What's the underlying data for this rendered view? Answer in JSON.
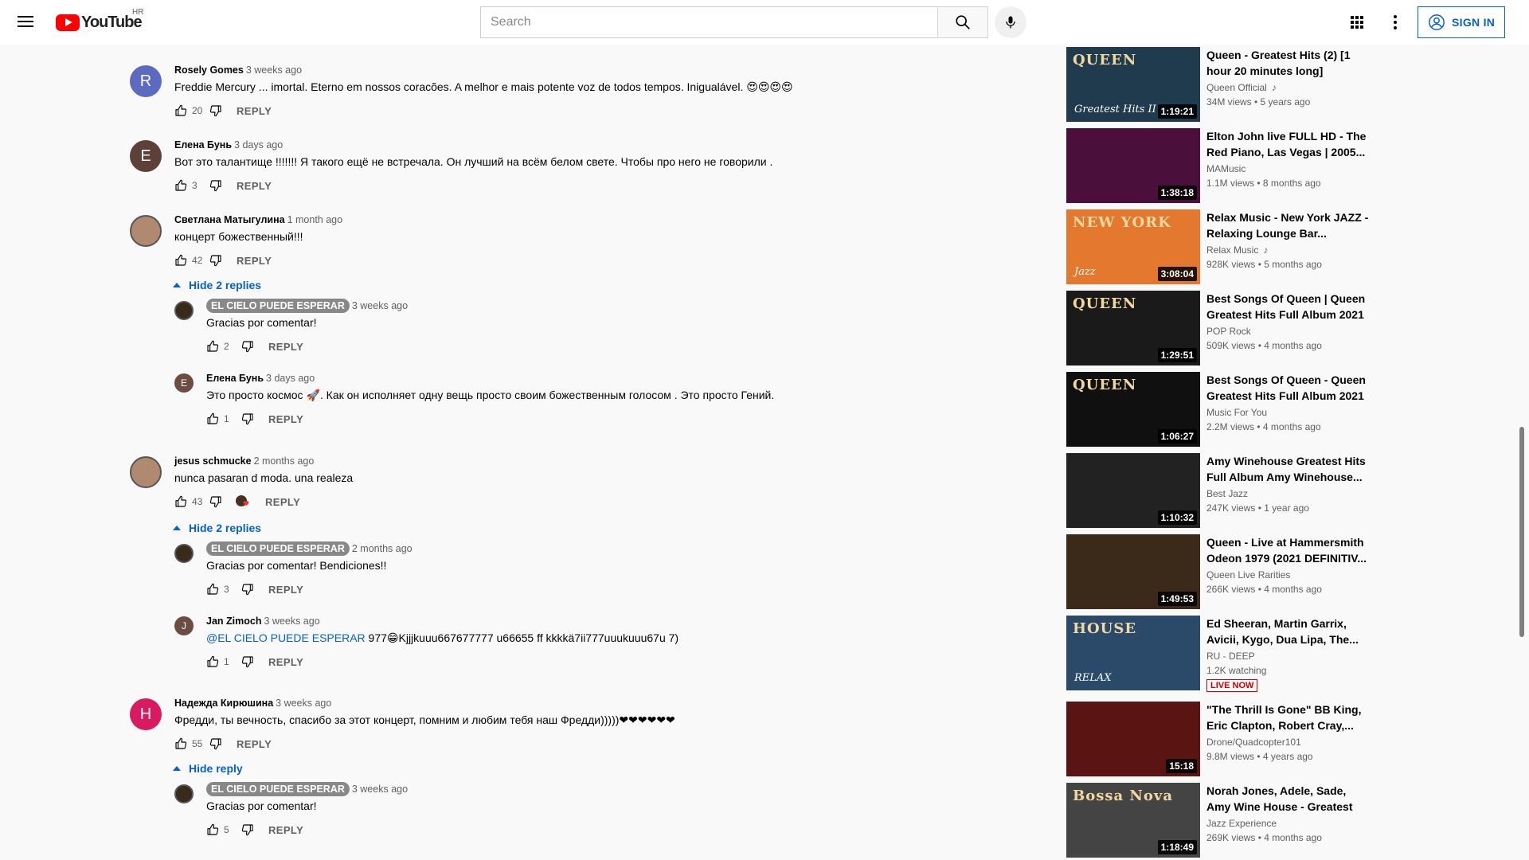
{
  "header": {
    "logo_text": "YouTube",
    "country": "HR",
    "search_placeholder": "Search",
    "signin_label": "SIGN IN"
  },
  "comments": [
    {
      "author": "Rosely Gomes",
      "time": "3 weeks ago",
      "text": "Freddie Mercury ... imortal. Eterno em nossos coracões. A melhor e mais potente voz de todos tempos. Inigualável. 😍😍😍😍",
      "likes": "20",
      "avatar_letter": "R",
      "avatar_color": "#5c6bc0"
    },
    {
      "author": "Елена Бунь",
      "time": "3 days ago",
      "text": "Вот это талантище !!!!!!! Я такого ещё не встречала. Он лучший на всём белом свете. Чтобы про него не говорили .",
      "likes": "3",
      "avatar_letter": "E",
      "avatar_color": "#5d4037"
    },
    {
      "author": "Светлана Матыгулина",
      "time": "1 month ago",
      "text": "концерт божественный!!!",
      "likes": "42",
      "hide_label": "Hide 2 replies",
      "replies": [
        {
          "author": "EL CIELO PUEDE ESPERAR",
          "time": "3 weeks ago",
          "text": "Gracias por comentar!",
          "likes": "2"
        },
        {
          "author": "Елена Бунь",
          "time": "3 days ago",
          "text": "Это просто космос 🚀. Как он исполняет одну вещь просто своим божественным голосом . Это просто Гений.",
          "likes": "1",
          "avatar_letter": "E"
        }
      ]
    },
    {
      "author": "jesus schmucke",
      "time": "2 months ago",
      "text": "nunca pasaran d moda. una realeza",
      "likes": "43",
      "hide_label": "Hide 2 replies",
      "replies": [
        {
          "author": "EL CIELO PUEDE ESPERAR",
          "time": "2 months ago",
          "text": "Gracias por comentar! Bendiciones!!",
          "likes": "3"
        },
        {
          "author": "Jan Zimoch",
          "time": "3 weeks ago",
          "mention": "@EL CIELO PUEDE ESPERAR",
          "text": " 977😁Kjjjkuuu667677777 u66655 ff kkkkä7ii777uuukuuu67u 7)",
          "likes": "1",
          "avatar_letter": "J"
        }
      ]
    },
    {
      "author": "Надежда Кирюшина",
      "time": "3 weeks ago",
      "text": "Фредди, ты вечность, спасибо за этот концерт, помним и любим тебя наш Фредди)))))❤❤❤❤❤❤",
      "likes": "55",
      "avatar_letter": "H",
      "avatar_color": "#d81b60",
      "hide_label": "Hide reply",
      "replies": [
        {
          "author": "EL CIELO PUEDE ESPERAR",
          "time": "3 weeks ago",
          "text": "Gracias por comentar!",
          "likes": "5"
        }
      ]
    }
  ],
  "reply_label": "REPLY",
  "recommendations": [
    {
      "title": "Queen - Greatest Hits (2) [1 hour 20 minutes long]",
      "channel": "Queen Official",
      "meta": "34M views • 5 years ago",
      "duration": "1:19:21",
      "thumb_color": "#1f3b4d",
      "thumb_text": "QUEEN",
      "thumb_subtext": "Greatest Hits II",
      "music_note": "♪"
    },
    {
      "title": "Elton John live FULL HD - The Red Piano, Las Vegas | 2005...",
      "channel": "MAMusic",
      "meta": "1.1M views • 8 months ago",
      "duration": "1:38:18",
      "thumb_color": "#4a0f3a"
    },
    {
      "title": "Relax Music - New York JAZZ - Relaxing Lounge Bar...",
      "channel": "Relax Music",
      "meta": "928K views • 5 months ago",
      "duration": "3:08:04",
      "thumb_color": "#e3782e",
      "thumb_text": "NEW YORK",
      "thumb_subtext": "Jazz",
      "music_note": "♪"
    },
    {
      "title": "Best Songs Of Queen | Queen Greatest Hits Full Album 2021",
      "channel": "POP Rock",
      "meta": "509K views • 4 months ago",
      "duration": "1:29:51",
      "thumb_color": "#1a1a1a",
      "thumb_text": "QUEEN"
    },
    {
      "title": "Best Songs Of Queen - Queen Greatest Hits Full Album 2021",
      "channel": "Music For You",
      "meta": "2.2M views • 4 months ago",
      "duration": "1:06:27",
      "thumb_color": "#101010",
      "thumb_text": "QUEEN"
    },
    {
      "title": "Amy Winehouse Greatest Hits Full Album Amy Winehouse...",
      "channel": "Best Jazz",
      "meta": "247K views • 1 year ago",
      "duration": "1:10:32",
      "thumb_color": "#222222"
    },
    {
      "title": "Queen - Live at Hammersmith Odeon 1979 (2021 DEFINITIV...",
      "channel": "Queen Live Rarities",
      "meta": "266K views • 4 months ago",
      "duration": "1:49:53",
      "thumb_color": "#3b2a1a"
    },
    {
      "title": "Ed Sheeran, Martin Garrix, Avicii, Kygo, Dua Lipa, The...",
      "channel": "RU - DEEP",
      "meta": "1.2K watching",
      "live_label": "LIVE NOW",
      "thumb_color": "#2b4a6a",
      "thumb_text": "HOUSE",
      "thumb_subtext": "RELAX"
    },
    {
      "title": "\"The Thrill Is Gone\" BB King, Eric Clapton, Robert Cray,...",
      "channel": "Drone/Quadcopter101",
      "meta": "9.8M views • 4 years ago",
      "duration": "15:18",
      "thumb_color": "#5a1512"
    },
    {
      "title": "Norah Jones, Adele, Sade, Amy Wine House - Greatest Bossa...",
      "channel": "Jazz Experience",
      "meta": "269K views • 4 months ago",
      "duration": "1:18:49",
      "thumb_color": "#444444",
      "thumb_text": "Bossa Nova"
    }
  ]
}
